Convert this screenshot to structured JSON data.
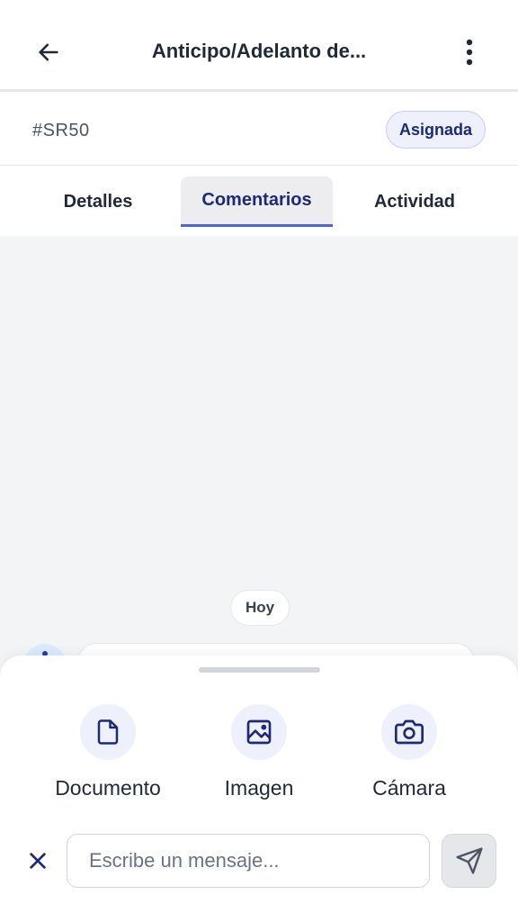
{
  "header": {
    "title": "Anticipo/Adelanto de...",
    "back_icon": "arrow-left-icon",
    "menu_icon": "more-vertical-icon"
  },
  "ticket": {
    "id": "#SR50",
    "status": "Asignada"
  },
  "tabs": [
    {
      "label": "Detalles",
      "active": false
    },
    {
      "label": "Comentarios",
      "active": true
    },
    {
      "label": "Actividad",
      "active": false
    }
  ],
  "chat": {
    "day_separator": "Hoy"
  },
  "attach_sheet": {
    "options": [
      {
        "label": "Documento",
        "icon": "file-icon"
      },
      {
        "label": "Imagen",
        "icon": "image-icon"
      },
      {
        "label": "Cámara",
        "icon": "camera-icon"
      }
    ]
  },
  "composer": {
    "placeholder": "Escribe un mensaje...",
    "value": "",
    "close_icon": "close-icon",
    "send_icon": "send-icon"
  },
  "colors": {
    "accent": "#4f63d9",
    "brand_dark": "#1e2a78",
    "badge_bg": "#eef0fc",
    "chat_bg": "#f3f4f6"
  }
}
